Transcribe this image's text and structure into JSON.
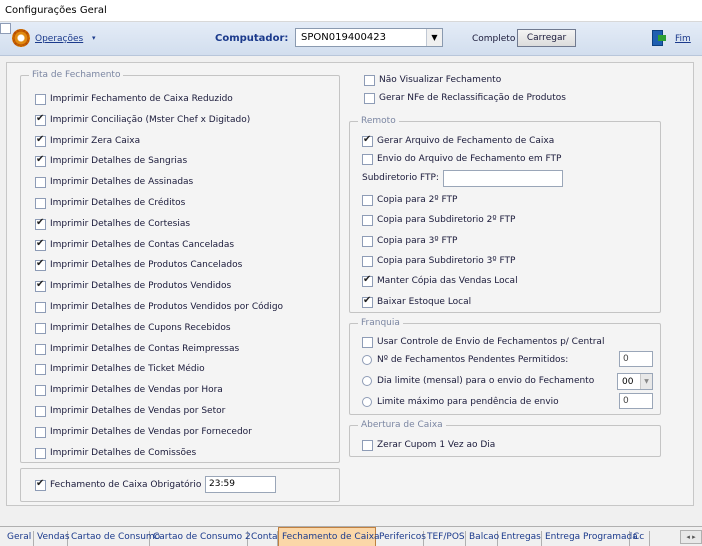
{
  "window": {
    "title": "Configurações Geral"
  },
  "toolbar": {
    "operations_label": "Operações",
    "operations_arrow": "▾",
    "computer_label": "Computador:",
    "computer_value": "SPON019400423",
    "complete_label": "Completo",
    "complete_checked": false,
    "load_label": "Carregar",
    "exit_label": "Fim"
  },
  "fita": {
    "title": "Fita de Fechamento",
    "items": [
      {
        "label": "Imprimir Fechamento de Caixa Reduzido",
        "checked": false
      },
      {
        "label": "Imprimir Conciliação (Mster Chef x Digitado)",
        "checked": true
      },
      {
        "label": "Imprimir Zera Caixa",
        "checked": true
      },
      {
        "label": "Imprimir Detalhes de Sangrias",
        "checked": true
      },
      {
        "label": "Imprimir Detalhes de Assinadas",
        "checked": false
      },
      {
        "label": "Imprimir Detalhes de Créditos",
        "checked": false
      },
      {
        "label": "Imprimir Detalhes de Cortesias",
        "checked": true
      },
      {
        "label": "Imprimir Detalhes de Contas Canceladas",
        "checked": true
      },
      {
        "label": "Imprimir Detalhes de Produtos Cancelados",
        "checked": true
      },
      {
        "label": "Imprimir Detalhes de Produtos Vendidos",
        "checked": true
      },
      {
        "label": "Imprimir Detalhes de Produtos Vendidos por Código",
        "checked": false
      },
      {
        "label": "Imprimir Detalhes de Cupons Recebidos",
        "checked": false
      },
      {
        "label": "Imprimir Detalhes de Contas Reimpressas",
        "checked": false
      },
      {
        "label": "Imprimir Detalhes de Ticket Médio",
        "checked": false
      },
      {
        "label": "Imprimir Detalhes de Vendas por Hora",
        "checked": false
      },
      {
        "label": "Imprimir Detalhes de Vendas por Setor",
        "checked": false
      },
      {
        "label": "Imprimir Detalhes de Vendas por Fornecedor",
        "checked": false
      },
      {
        "label": "Imprimir Detalhes de Comissões",
        "checked": false
      }
    ]
  },
  "obrigatorio": {
    "label": "Fechamento de Caixa Obrigatório",
    "checked": true,
    "time": "23:59"
  },
  "top_right": {
    "items": [
      {
        "label": "Não Visualizar Fechamento",
        "checked": false
      },
      {
        "label": "Gerar NFe de Reclassificação de Produtos",
        "checked": false
      }
    ]
  },
  "remoto": {
    "title": "Remoto",
    "items_a": [
      {
        "label": "Gerar Arquivo de Fechamento de Caixa",
        "checked": true
      },
      {
        "label": "Envio do Arquivo de Fechamento em FTP",
        "checked": false
      }
    ],
    "subdir_label": "Subdiretorio FTP:",
    "subdir_value": "",
    "items_b": [
      {
        "label": "Copia para 2º FTP",
        "checked": false
      },
      {
        "label": "Copia para Subdiretorio 2º FTP",
        "checked": false
      },
      {
        "label": "Copia para 3º FTP",
        "checked": false
      },
      {
        "label": "Copia para Subdiretorio 3º FTP",
        "checked": false
      },
      {
        "label": "Manter Cópia das Vendas Local",
        "checked": true
      },
      {
        "label": "Baixar Estoque Local",
        "checked": true
      }
    ]
  },
  "franquia": {
    "title": "Franquia",
    "control_label": "Usar Controle de Envio de Fechamentos p/ Central",
    "control_checked": false,
    "pending_label": "Nº de Fechamentos Pendentes Permitidos:",
    "pending_value": "0",
    "day_label": "Dia limite (mensal) para o envio do Fechamento",
    "day_value": "00",
    "limit_label": "Limite máximo para pendência de envio",
    "limit_value": "0"
  },
  "abertura": {
    "title": "Abertura de Caixa",
    "label": "Zerar Cupom 1 Vez ao Dia",
    "checked": false
  },
  "tabs": {
    "items": [
      "Geral",
      "Vendas",
      "Cartao de Consumo",
      "Cartao de Consumo 2",
      "Conta",
      "Fechamento de Caixa",
      "Perifericos",
      "TEF/POS",
      "Balcao",
      "Entregas",
      "Entrega Programada",
      "Cc"
    ],
    "active": "Fechamento de Caixa",
    "scroll": "◂ ▸"
  },
  "colors": {
    "accent_tab": "#fbd7a8",
    "link": "#1b3a8c",
    "group_title": "#7b86a2"
  }
}
